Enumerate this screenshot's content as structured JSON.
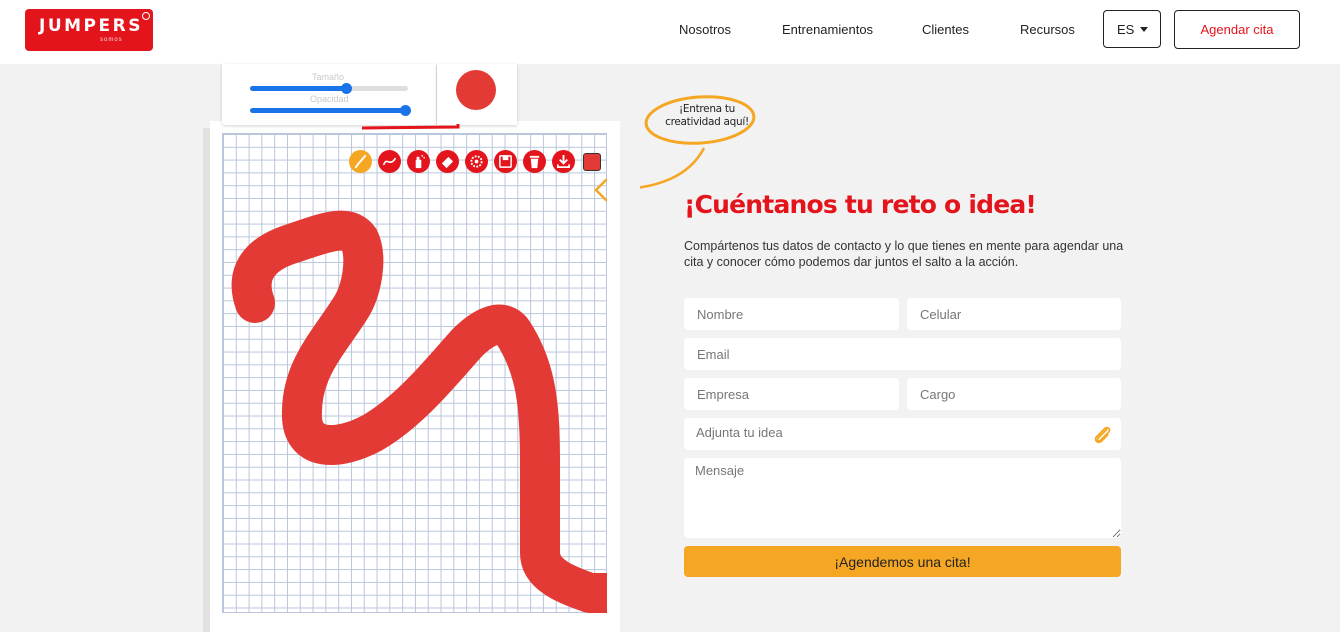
{
  "brand": {
    "name": "JUMPERS",
    "sub": "somos",
    "accent": "#e3141b"
  },
  "nav": {
    "items": [
      {
        "label": "Nosotros"
      },
      {
        "label": "Entrenamientos"
      },
      {
        "label": "Clientes"
      },
      {
        "label": "Recursos"
      }
    ],
    "language": "ES",
    "cta": "Agendar cita"
  },
  "canvas": {
    "size_label": "Tamaño",
    "size_value": 0.61,
    "opacity_label": "Opacidad",
    "opacity_value": 0.98,
    "brush_color": "#e33a36",
    "tools": [
      {
        "icon": "brush-icon",
        "active": true
      },
      {
        "icon": "curve-icon",
        "active": false
      },
      {
        "icon": "spray-icon",
        "active": false
      },
      {
        "icon": "eraser-icon",
        "active": false
      },
      {
        "icon": "settings-icon",
        "active": false
      },
      {
        "icon": "save-icon",
        "active": false
      },
      {
        "icon": "trash-icon",
        "active": false
      },
      {
        "icon": "download-icon",
        "active": false
      }
    ],
    "callout": "¡Entrena tu creatividad aquí!"
  },
  "form": {
    "title": "¡Cuéntanos tu reto o idea!",
    "description": "Compártenos tus datos de contacto y lo que tienes en mente para agendar una cita y conocer cómo podemos dar juntos el salto a la acción.",
    "name_placeholder": "Nombre",
    "phone_placeholder": "Celular",
    "email_placeholder": "Email",
    "company_placeholder": "Empresa",
    "position_placeholder": "Cargo",
    "attach_label": "Adjunta tu idea",
    "message_placeholder": "Mensaje",
    "submit_label": "¡Agendemos una cita!",
    "submit_color": "#f5a623"
  }
}
